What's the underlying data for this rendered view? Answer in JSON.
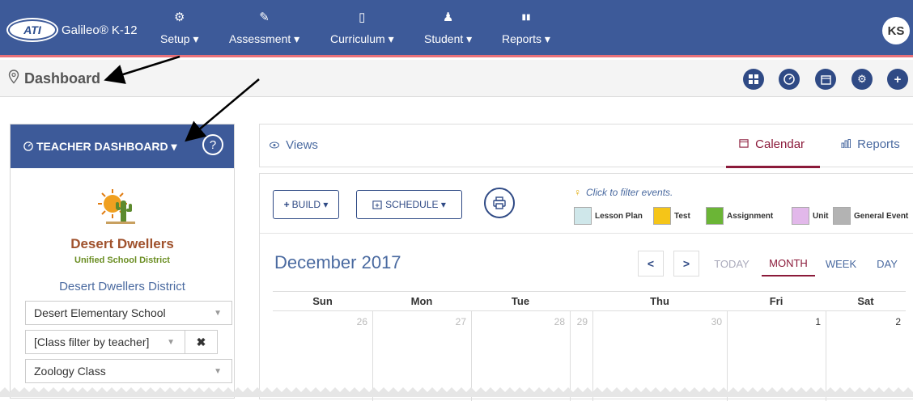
{
  "app": {
    "brand_logo": "ATI",
    "brand_name": "Galileo® K-12"
  },
  "nav": [
    {
      "icon": "gear-icon",
      "glyph": "⚙",
      "label": "Setup ▾"
    },
    {
      "icon": "edit-icon",
      "glyph": "✎",
      "label": "Assessment ▾"
    },
    {
      "icon": "book-icon",
      "glyph": "▯",
      "label": "Curriculum ▾"
    },
    {
      "icon": "student-icon",
      "glyph": "♟",
      "label": "Student ▾"
    },
    {
      "icon": "bar-chart-icon",
      "glyph": "▮▮",
      "label": "Reports ▾"
    }
  ],
  "user": {
    "initials": "KS"
  },
  "breadcrumb": {
    "label": "Dashboard"
  },
  "subbar_buttons": [
    "grid-icon",
    "gauge-icon",
    "calendar-icon",
    "gear-icon",
    "plus-icon"
  ],
  "teacher_panel": {
    "title": "TEACHER DASHBOARD ▾",
    "help": "?",
    "district_title": "Desert Dwellers",
    "district_sub": "Unified School District",
    "district_name": "Desert Dwellers District",
    "school_select": "Desert Elementary School",
    "class_filter": "[Class filter by teacher]",
    "class_select": "Zoology Class",
    "clear": "✖"
  },
  "views": {
    "label": "Views",
    "tab_calendar": "Calendar",
    "tab_reports": "Reports"
  },
  "calendar": {
    "build_label": "BUILD ▾",
    "schedule_label": "SCHEDULE ▾",
    "filter_hint": "Click to filter events.",
    "legend": [
      {
        "label": "Lesson Plan",
        "color": "#cfe7ea"
      },
      {
        "label": "Test",
        "color": "#f5c518"
      },
      {
        "label": "Assignment",
        "color": "#6bb536"
      },
      {
        "label": "Unit",
        "color": "#e2b8ea"
      },
      {
        "label": "General Event",
        "color": "#b3b3b3"
      }
    ],
    "month_title": "December 2017",
    "prev": "<",
    "next": ">",
    "view_today": "TODAY",
    "view_month": "MONTH",
    "view_week": "WEEK",
    "view_day": "DAY",
    "days": [
      "Sun",
      "Mon",
      "Tue",
      "Thu",
      "Fri",
      "Sat"
    ],
    "dates": [
      "26",
      "27",
      "28",
      "29",
      "30",
      "1",
      "2"
    ]
  },
  "colors": {
    "header": "#3d5a99",
    "accent": "#8b1a3a",
    "button": "#2f4a85"
  }
}
